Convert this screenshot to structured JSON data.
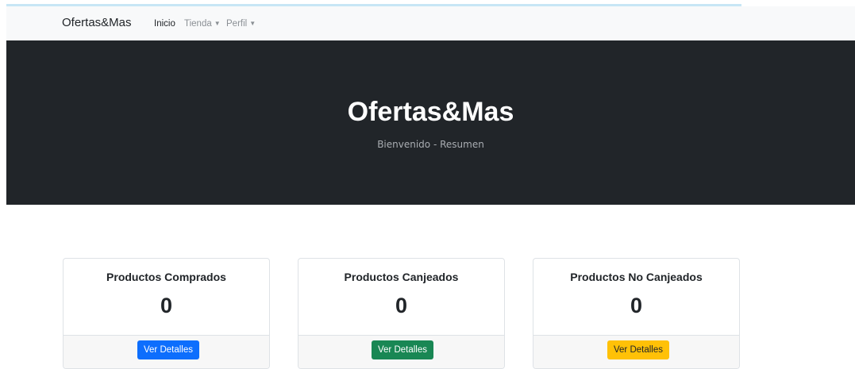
{
  "navbar": {
    "brand": "Ofertas&Mas",
    "links": [
      {
        "label": "Inicio"
      },
      {
        "label": "Tienda",
        "dropdown": true
      },
      {
        "label": "Perfil",
        "dropdown": true
      }
    ]
  },
  "hero": {
    "title": "Ofertas&Mas",
    "subtitle": "Bienvenido - Resumen"
  },
  "cards": [
    {
      "title": "Productos Comprados",
      "value": "0",
      "button_label": "Ver Detalles",
      "button_color": "#0d6efd"
    },
    {
      "title": "Productos Canjeados",
      "value": "0",
      "button_label": "Ver Detalles",
      "button_color": "#198754"
    },
    {
      "title": "Productos No Canjeados",
      "value": "0",
      "button_label": "Ver Detalles",
      "button_color": "#ffc107"
    }
  ],
  "icons": {
    "dropdown": "caret-down-icon"
  },
  "colors": {
    "navbar_bg": "#f8f9fa",
    "hero_bg": "#212529",
    "primary": "#0d6efd",
    "success": "#198754",
    "warning": "#ffc107"
  }
}
